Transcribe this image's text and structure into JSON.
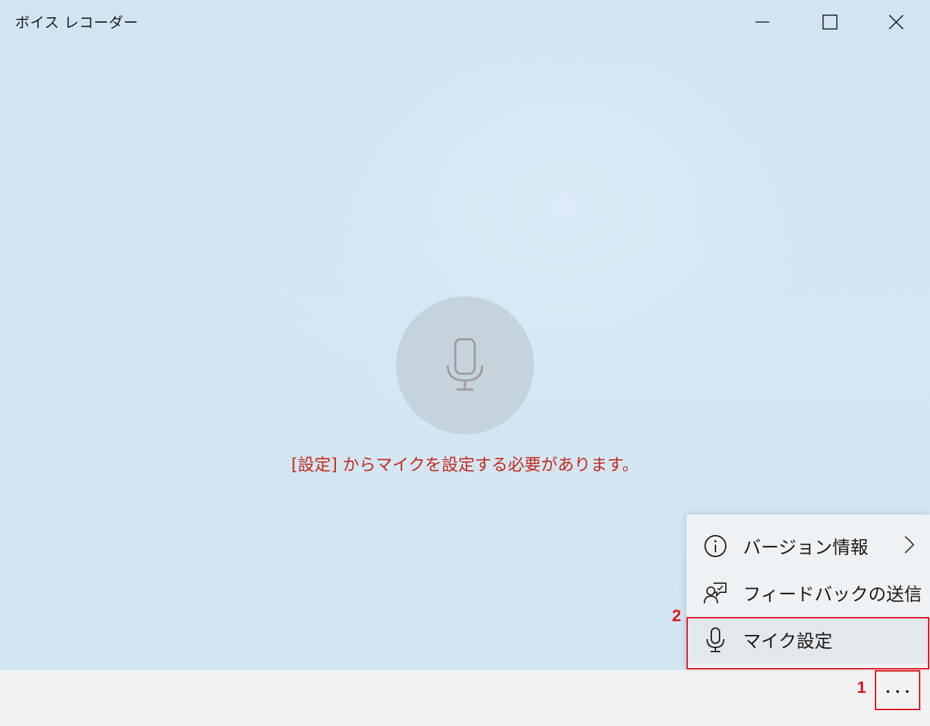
{
  "window": {
    "title": "ボイス レコーダー"
  },
  "main": {
    "error_message": "[設定] からマイクを設定する必要があります。"
  },
  "menu": {
    "items": [
      {
        "label": "バージョン情報",
        "icon": "info-icon",
        "has_submenu": true
      },
      {
        "label": "フィードバックの送信",
        "icon": "feedback-icon",
        "has_submenu": false
      },
      {
        "label": "マイク設定",
        "icon": "microphone-icon",
        "has_submenu": false
      }
    ]
  },
  "annotations": {
    "step1": "1",
    "step2": "2"
  },
  "colors": {
    "accent_red": "#e0161d",
    "error_text": "#c42b1c",
    "background": "#d4e6f3",
    "bottom_bar": "#f2f2f2"
  }
}
